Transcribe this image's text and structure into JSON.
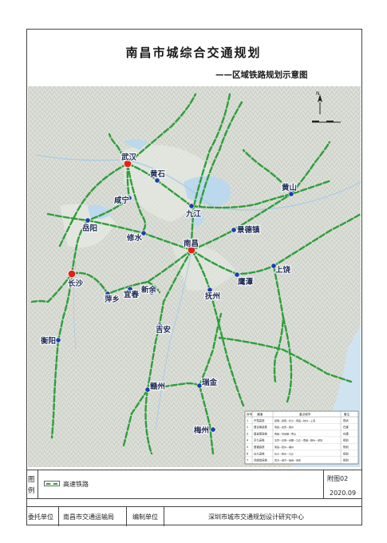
{
  "header": {
    "title": "南昌市城综合交通规划",
    "subtitle": "——区域铁路规划示意图"
  },
  "compass": {
    "label": "N"
  },
  "map": {
    "cities_major": [
      {
        "name": "武汉"
      },
      {
        "name": "南昌"
      },
      {
        "name": "长沙"
      }
    ],
    "cities": [
      {
        "name": "黄石"
      },
      {
        "name": "咸宁"
      },
      {
        "name": "岳阳"
      },
      {
        "name": "修水"
      },
      {
        "name": "九江"
      },
      {
        "name": "黄山"
      },
      {
        "name": "景德镇"
      },
      {
        "name": "鹰潭"
      },
      {
        "name": "上饶"
      },
      {
        "name": "萍乡"
      },
      {
        "name": "宜春"
      },
      {
        "name": "新余"
      },
      {
        "name": "抚州"
      },
      {
        "name": "吉安"
      },
      {
        "name": "衡阳"
      },
      {
        "name": "赣州"
      },
      {
        "name": "瑞金"
      },
      {
        "name": "梅州"
      }
    ]
  },
  "table": {
    "headers": [
      "序号",
      "通道",
      "重点城市",
      "备注"
    ],
    "rows": [
      [
        "1",
        "沪昆高铁",
        "昆明—贵阳—长沙—南昌—杭州—上海",
        "现状"
      ],
      [
        "2",
        "昌吉赣高铁",
        "南昌—吉安—赣州",
        "在建"
      ],
      [
        "3",
        "昌景黄高铁",
        "南昌—景德镇—黄山",
        "在建"
      ],
      [
        "4",
        "京九高铁",
        "北京—阜阳—合肥—九江—南昌—赣州—深圳",
        "规划"
      ],
      [
        "5",
        "昌福高铁",
        "南昌—抚州—福州",
        "规划"
      ],
      [
        "6",
        "长九高铁",
        "长沙—修水—九江",
        "规划"
      ],
      [
        "7",
        "武咸宜高铁",
        "武汉—咸宁—宜春—吉安",
        "规划"
      ]
    ]
  },
  "legend": {
    "heading": "图例",
    "item": "高速铁路"
  },
  "footer": {
    "figure_no": "附图02",
    "date": "2020.09",
    "client_label": "委托单位",
    "client": "南昌市交通运输局",
    "author_label": "编制单位",
    "author": "深圳市城市交通规划设计研究中心"
  },
  "colors": {
    "rail": "#2e9e3a",
    "city_dot": "#1f3fa8",
    "major_dot": "#e0221b",
    "water": "#cfe3f1",
    "land": "#d8ddd6"
  }
}
